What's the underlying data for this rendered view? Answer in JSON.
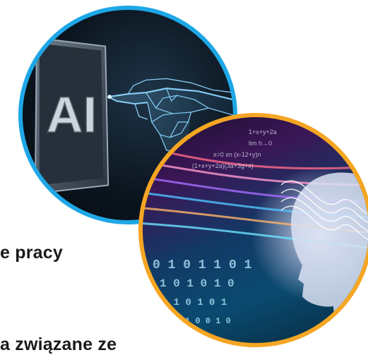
{
  "images": {
    "ai_image": {
      "label": "AI",
      "border_color": "#1ea7e6"
    },
    "brain_image": {
      "border_color": "#f5a623"
    }
  },
  "text": {
    "line1": "e pracy",
    "line2": "a związane ze"
  },
  "colors": {
    "text": "#1a1a1a",
    "background": "#ffffff"
  }
}
